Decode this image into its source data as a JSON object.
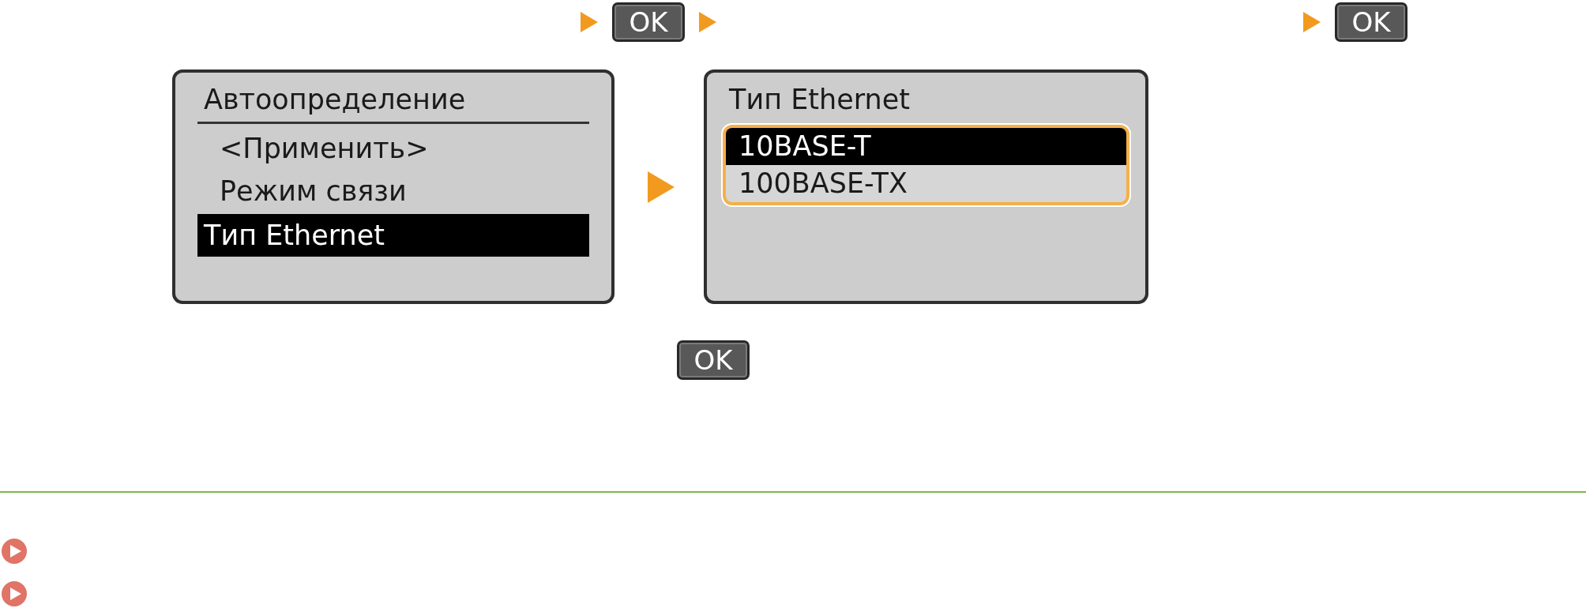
{
  "top_steps": [
    {
      "kind": "arrow"
    },
    {
      "kind": "ok_key",
      "label": "OK"
    },
    {
      "kind": "arrow"
    },
    {
      "kind": "gap"
    },
    {
      "kind": "arrow"
    },
    {
      "kind": "ok_key",
      "label": "OK"
    }
  ],
  "screens": [
    {
      "kind": "menu",
      "title": "Автоопределение",
      "items": [
        {
          "label": "<Применить>",
          "selected": false
        },
        {
          "label": "Режим связи",
          "selected": false
        },
        {
          "label": "Тип Ethernet",
          "selected": true
        }
      ]
    },
    {
      "kind": "options",
      "title": "Тип Ethernet",
      "items": [
        {
          "label": "10BASE-T",
          "selected": true
        },
        {
          "label": "100BASE-TX",
          "selected": false
        }
      ]
    }
  ],
  "final_key": {
    "label": "OK"
  },
  "related_links": [
    {
      "kind": "bullet"
    },
    {
      "kind": "bullet"
    }
  ]
}
